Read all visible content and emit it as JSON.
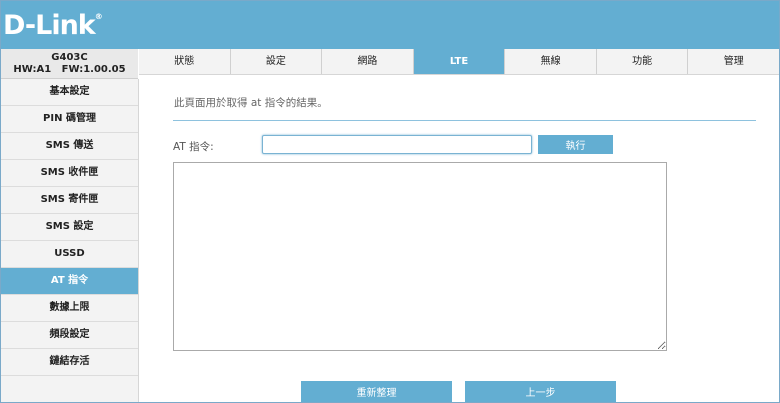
{
  "brand": {
    "name": "D-Link",
    "reg": "®"
  },
  "device": {
    "model": "G403C",
    "version": "HW:A1   FW:1.00.05"
  },
  "tabs": [
    {
      "label": "狀態"
    },
    {
      "label": "設定"
    },
    {
      "label": "網路"
    },
    {
      "label": "LTE",
      "active": true
    },
    {
      "label": "無線"
    },
    {
      "label": "功能"
    },
    {
      "label": "管理"
    }
  ],
  "sidebar": {
    "items": [
      {
        "label": "基本設定"
      },
      {
        "label": "PIN 碼管理"
      },
      {
        "label": "SMS 傳送"
      },
      {
        "label": "SMS 收件匣"
      },
      {
        "label": "SMS 寄件匣"
      },
      {
        "label": "SMS 設定"
      },
      {
        "label": "USSD"
      },
      {
        "label": "AT 指令",
        "active": true
      },
      {
        "label": "數據上限"
      },
      {
        "label": "頻段設定"
      },
      {
        "label": "鏈結存活"
      }
    ]
  },
  "main": {
    "description": "此頁面用於取得 at 指令的結果。",
    "at_label": "AT 指令:",
    "at_value": "",
    "exec_label": "執行",
    "result_value": "",
    "refresh_label": "重新整理",
    "back_label": "上一步"
  },
  "colors": {
    "accent": "#63aed2",
    "sidebar_bg": "#f3f3f3"
  }
}
